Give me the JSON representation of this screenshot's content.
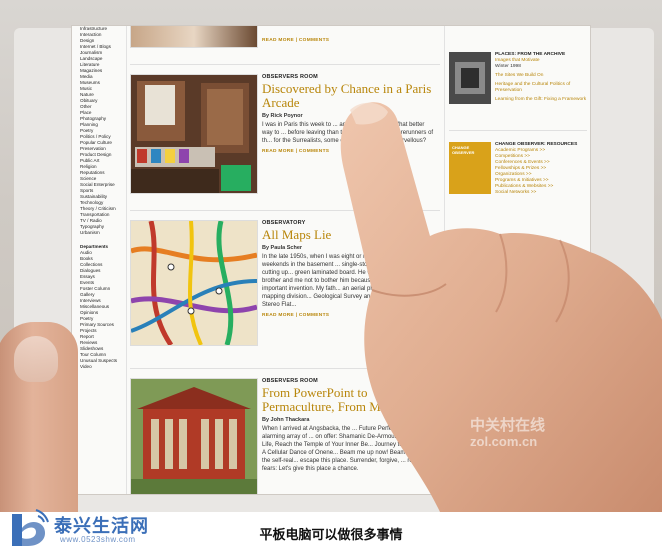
{
  "nav": {
    "items": [
      "Infrastructure",
      "Interaction",
      "Design",
      "Internet / Blogs",
      "Journalism",
      "Landscape",
      "Literature",
      "Magazines",
      "Media",
      "Museums",
      "Music",
      "Nature",
      "Obituary",
      "Other",
      "Place",
      "Photography",
      "Planning",
      "Poetry",
      "Politics / Policy",
      "Popular Culture",
      "Preservation",
      "Product Design",
      "Public Art",
      "Religion",
      "Reputations",
      "Science",
      "Social Enterprise",
      "Sports",
      "Sustainability",
      "Technology",
      "Theory / Criticism",
      "Transportation",
      "TV / Radio",
      "Typography",
      "Urbanism"
    ],
    "departments_heading": "Departments",
    "departments": [
      "Audio",
      "Books",
      "Collections",
      "Dialogues",
      "Essays",
      "Events",
      "Foster Column",
      "Gallery",
      "Interviews",
      "Miscellaneous",
      "Opinions",
      "Poetry",
      "Primary Sources",
      "Projects",
      "Report",
      "Reviews",
      "Slideshows",
      "Tour Column",
      "Unusual Suspects",
      "Video"
    ]
  },
  "articles": [
    {
      "readmore": "READ MORE | COMMENTS"
    },
    {
      "kicker": "OBSERVERS ROOM",
      "title": "Discovered by Chance in a Paris Arcade",
      "byline": "By Rick Poynor",
      "body": "I was in Paris this week to ... and graphic design. What better way to ... before leaving than to pay ... arcades — forerunners of th... for the Surrealists, some of t... encounter the marvellous?",
      "readmore": "READ MORE | COMMENTS"
    },
    {
      "kicker": "OBSERVATORY",
      "title": "All Maps Lie",
      "byline": "By Paula Scher",
      "body": "In the late 1950s, when I was eight or nin... father spent his weekends in the basement ... single-story house, measuring and cutting up... green laminated board. He would occasiona... my brother and me not to bother him because... constructing an important invention. My fath... an aerial photography in the mapping division... Geological Survey and he said his invention Stereo Flat...",
      "readmore": "READ MORE | COMMENTS"
    },
    {
      "kicker": "OBSERVERS ROOM",
      "title": "From PowerPoint to Permaculture, From M...",
      "byline": "By John Thackara",
      "body": "When I arrived at Angsbacka, the ... Future Perfect Festival, an alarming array of ... on offer: Shamanic De-Armouring, ... Your Life, Reach the Temple of Your Inner Be... Journey to Bliss, and A Cellular Dance of Onene... Beam me up now! Beam me into the self-real... escape this place. Surrender, forgive, ... release fears: Let's give this place a chance."
    }
  ],
  "sidebar": {
    "blocks": [
      {
        "heading": "PLACES: FROM THE ARCHIVE",
        "subheading": "Images that Motivate",
        "date": "Winter 1998",
        "links": [
          "The Sites We Build On",
          "Heritage and the Cultural Politics of Preservation",
          "Learning from the Gift: Fixing a Framework"
        ]
      },
      {
        "heading": "CHANGE OBSERVER: RESOURCES",
        "badge": "CHANGE OBSERVER",
        "links": [
          "Academic Programs >>",
          "Competitions >>",
          "Conferences & Events >>",
          "Fellowships & Prizes >>",
          "Organizations >>",
          "Programs & Initiatives >>",
          "Publications & Websites >>",
          "Social Networks >>"
        ]
      }
    ]
  },
  "watermark": {
    "line1": "中关村在线",
    "line2": "zol.com.cn"
  },
  "site": {
    "name": "泰兴生活网",
    "url": "www.0523shw.com"
  },
  "caption": "平板电脑可以做很多事情",
  "colors": {
    "accent": "#b8860b",
    "site_blue": "#3b6fb8"
  }
}
